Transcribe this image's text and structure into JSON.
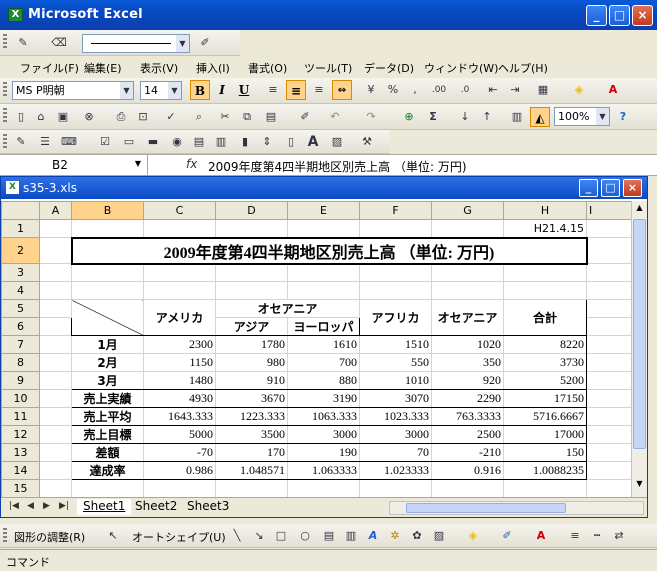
{
  "window": {
    "title": "Microsoft Excel"
  },
  "menu": [
    "ファイル(F)",
    "編集(E)",
    "表示(V)",
    "挿入(I)",
    "書式(O)",
    "ツール(T)",
    "データ(D)",
    "ウィンドウ(W)",
    "ヘルプ(H)"
  ],
  "format": {
    "font": "MS P明朝",
    "size": "14",
    "bold": "B",
    "italic": "I",
    "underline": "U",
    "zoom": "100%"
  },
  "formula_bar": {
    "cell_ref": "B2",
    "fx": "fx",
    "content": "2009年度第4四半期地区別売上高 （単位: 万円)"
  },
  "workbook": {
    "title": "s35-3.xls"
  },
  "columns": [
    "A",
    "B",
    "C",
    "D",
    "E",
    "F",
    "G",
    "H",
    "I"
  ],
  "rows": [
    "1",
    "2",
    "3",
    "4",
    "5",
    "6",
    "7",
    "8",
    "9",
    "10",
    "11",
    "12",
    "13",
    "14",
    "15"
  ],
  "sheet": {
    "date": "H21.4.15",
    "title": "2009年度第4四半期地区別売上高 （単位: 万円)",
    "hdr_america": "アメリカ",
    "hdr_oceania_group": "オセアニア",
    "hdr_asia": "アジア",
    "hdr_europe": "ヨーロッパ",
    "hdr_africa": "アフリカ",
    "hdr_oceania": "オセアニア",
    "hdr_total": "合計",
    "data": [
      [
        "1月",
        "2300",
        "1780",
        "1610",
        "1510",
        "1020",
        "8220"
      ],
      [
        "2月",
        "1150",
        "980",
        "700",
        "550",
        "350",
        "3730"
      ],
      [
        "3月",
        "1480",
        "910",
        "880",
        "1010",
        "920",
        "5200"
      ],
      [
        "売上実績",
        "4930",
        "3670",
        "3190",
        "3070",
        "2290",
        "17150"
      ],
      [
        "売上平均",
        "1643.333",
        "1223.333",
        "1063.333",
        "1023.333",
        "763.3333",
        "5716.6667"
      ],
      [
        "売上目標",
        "5000",
        "3500",
        "3000",
        "3000",
        "2500",
        "17000"
      ],
      [
        "差額",
        "-70",
        "170",
        "190",
        "70",
        "-210",
        "150"
      ],
      [
        "達成率",
        "0.986",
        "1.048571",
        "1.063333",
        "1.023333",
        "0.916",
        "1.0088235"
      ]
    ]
  },
  "tabs": [
    "Sheet1",
    "Sheet2",
    "Sheet3"
  ],
  "drawing": {
    "adjust": "図形の調整(R)",
    "autoshape": "オートシェイプ(U)"
  },
  "status": "コマンド"
}
